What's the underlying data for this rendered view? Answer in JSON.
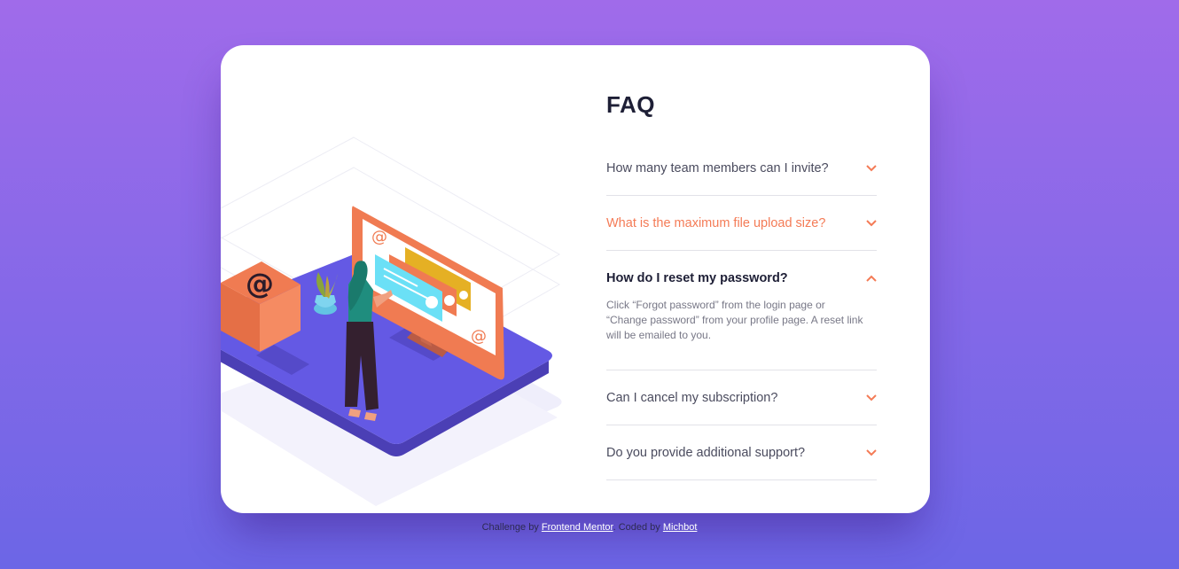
{
  "faq": {
    "title": "FAQ",
    "items": [
      {
        "question": "How many team members can I invite?",
        "state": "collapsed"
      },
      {
        "question": "What is the maximum file upload size?",
        "state": "hover"
      },
      {
        "question": "How do I reset my password?",
        "state": "expanded",
        "answer": "Click “Forgot password” from the login page or “Change password” from your profile page. A reset link will be emailed to you."
      },
      {
        "question": "Can I cancel my subscription?",
        "state": "collapsed"
      },
      {
        "question": "Do you provide additional support?",
        "state": "collapsed"
      }
    ],
    "accent_color": "#f47b56"
  },
  "footer": {
    "prefix": "Challenge by",
    "link1": "Frontend Mentor",
    "middle": ". Coded by",
    "link2": "Michbot"
  },
  "icons": {
    "chevron": "chevron-down-icon",
    "chevron_open": "chevron-up-icon"
  }
}
